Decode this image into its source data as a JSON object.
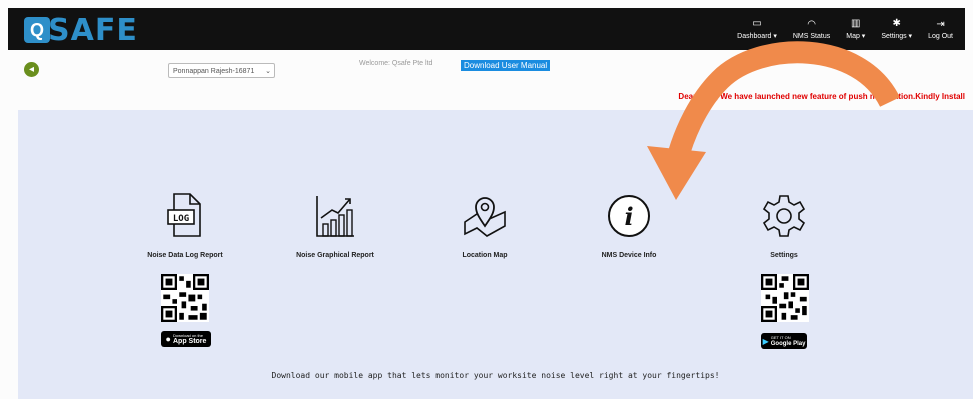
{
  "brand": {
    "logo_text": "SAFE",
    "logo_mark": "Q"
  },
  "nav": [
    {
      "icon": "monitor-icon",
      "glyph": "▭",
      "label": "Dashboard ▾"
    },
    {
      "icon": "wifi-icon",
      "glyph": "◠",
      "label": "NMS Status"
    },
    {
      "icon": "map-icon",
      "glyph": "▥",
      "label": "Map ▾"
    },
    {
      "icon": "gear-icon",
      "glyph": "✱",
      "label": "Settings ▾"
    },
    {
      "icon": "logout-icon",
      "glyph": "⇥",
      "label": "Log Out"
    }
  ],
  "subheader": {
    "back_glyph": "◂",
    "user_select": "Ponnappan Rajesh-16871",
    "welcome": "Welcome: Qsafe Pte ltd",
    "manual": "Download User Manual",
    "notice": "Dear User, We have launched new feature of push notification.Kindly Install"
  },
  "tiles": [
    {
      "name": "noise-data-log-report",
      "label": "Noise Data Log Report",
      "icon": "log-file-icon"
    },
    {
      "name": "noise-graphical-report",
      "label": "Noise Graphical Report",
      "icon": "bar-chart-icon"
    },
    {
      "name": "location-map",
      "label": "Location Map",
      "icon": "map-pin-icon"
    },
    {
      "name": "nms-device-info",
      "label": "NMS Device Info",
      "icon": "info-icon"
    },
    {
      "name": "settings",
      "label": "Settings",
      "icon": "gear-icon"
    }
  ],
  "app_store": {
    "small": "Download on the",
    "label": "App Store"
  },
  "google_play": {
    "small": "GET IT ON",
    "label": "Google Play"
  },
  "promo": "Download our mobile app that lets monitor your worksite noise level right at your fingertips!"
}
